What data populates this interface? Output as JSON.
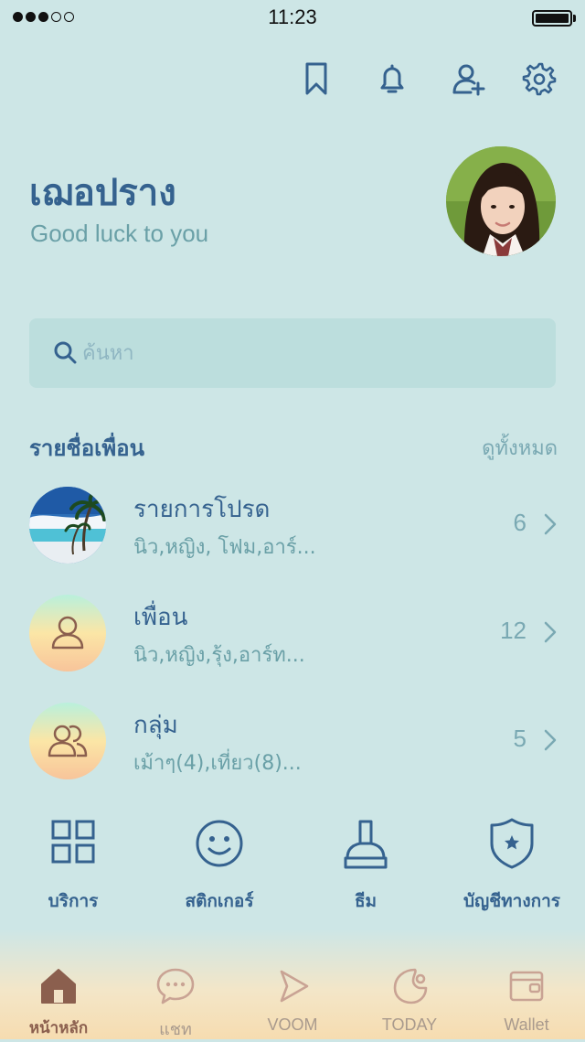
{
  "status_bar": {
    "time": "11:23"
  },
  "profile": {
    "name": "เฌอปราง",
    "status_message": "Good luck to you"
  },
  "search": {
    "placeholder": "ค้นหา"
  },
  "friends_section": {
    "title": "รายชื่อเพื่อน",
    "see_all": "ดูทั้งหมด",
    "rows": [
      {
        "title": "รายการโปรด",
        "subtitle": "นิว,หญิง, โฟม,อาร์...",
        "count": "6"
      },
      {
        "title": "เพื่อน",
        "subtitle": "นิว,หญิง,รุ้ง,อาร์ท...",
        "count": "12"
      },
      {
        "title": "กลุ่ม",
        "subtitle": "เม้าๆ(4),เที่ยว(8)...",
        "count": "5"
      }
    ]
  },
  "shortcuts": [
    {
      "label": "บริการ",
      "icon": "grid-icon"
    },
    {
      "label": "สติกเกอร์",
      "icon": "smiley-icon"
    },
    {
      "label": "ธีม",
      "icon": "brush-icon"
    },
    {
      "label": "บัญชีทางการ",
      "icon": "shield-star-icon"
    }
  ],
  "tab_bar": [
    {
      "label": "หน้าหลัก",
      "icon": "home-icon",
      "active": true
    },
    {
      "label": "แชท",
      "icon": "chat-icon",
      "active": false
    },
    {
      "label": "VOOM",
      "icon": "play-icon",
      "active": false
    },
    {
      "label": "TODAY",
      "icon": "moon-icon",
      "active": false
    },
    {
      "label": "Wallet",
      "icon": "wallet-icon",
      "active": false
    }
  ],
  "colors": {
    "background": "#cde6e6",
    "primary": "#35628f",
    "secondary_text": "#6aa0a7",
    "tab_active": "#8b5f4e"
  }
}
